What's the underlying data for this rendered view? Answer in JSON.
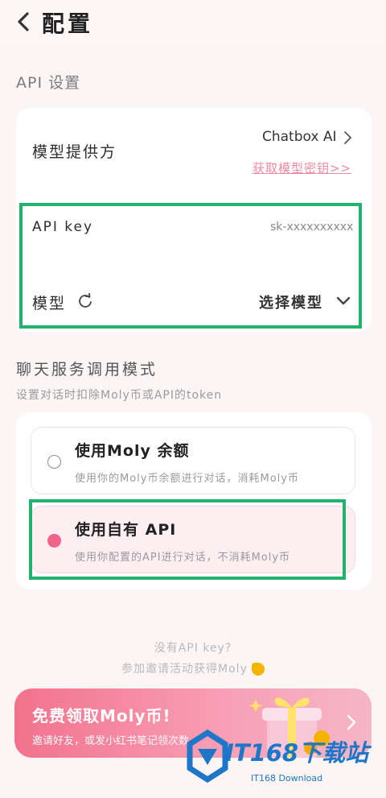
{
  "header": {
    "title": "配置"
  },
  "api_section": {
    "label": "API 设置",
    "provider_label": "模型提供方",
    "provider_value": "Chatbox AI",
    "get_key_link": "获取模型密钥>>",
    "api_key_label": "API key",
    "api_key_value": "sk-xxxxxxxxxx",
    "model_label": "模型",
    "model_select": "选择模型"
  },
  "chat_section": {
    "label": "聊天服务调用模式",
    "description": "设置对话时扣除Moly币或API的token",
    "options": [
      {
        "title": "使用Moly 余额",
        "desc": "使用你的Moly币余额进行对话，消耗Moly币",
        "selected": false
      },
      {
        "title": "使用自有 API",
        "desc": "使用你配置的API进行对话，不消耗Moly币",
        "selected": true
      }
    ]
  },
  "hint": {
    "line1": "没有API key?",
    "line2": "参加邀请活动获得Moly"
  },
  "banner": {
    "title": "免费领取Moly币!",
    "subtitle": "邀请好友，或发小红书笔记领次数"
  },
  "watermark": {
    "text": "IT168下载站",
    "subtext": "IT168 Download"
  },
  "colors": {
    "accent": "#f0648a",
    "highlight_box": "#21b26e",
    "link": "#f08aa3"
  }
}
